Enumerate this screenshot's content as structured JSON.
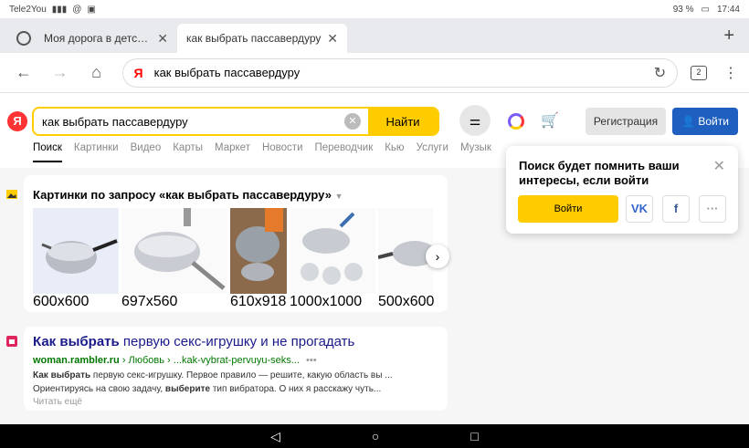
{
  "status": {
    "carrier": "Tele2You",
    "battery": "93 %",
    "time": "17:44"
  },
  "tabs": [
    {
      "title": "Моя дорога в детство - Стр"
    },
    {
      "title": "как выбрать пассавердуру"
    }
  ],
  "address": {
    "query": "как выбрать пассавердуру",
    "tab_count": "2"
  },
  "serp": {
    "logo": "Я",
    "search_value": "как выбрать пассавердуру",
    "find_label": "Найти",
    "register_label": "Регистрация",
    "login_label": "Войти",
    "tabs": [
      "Поиск",
      "Картинки",
      "Видео",
      "Карты",
      "Маркет",
      "Новости",
      "Переводчик",
      "Кью",
      "Услуги",
      "Музык"
    ]
  },
  "images": {
    "title": "Картинки по запросу «как выбрать пассавердуру»",
    "sizes": [
      "600x600",
      "697x560",
      "610x918",
      "1000x1000",
      "500x600"
    ]
  },
  "result": {
    "title_bold": "Как выбрать",
    "title_rest": " первую секс-игрушку и не прогадать",
    "url_domain": "woman.rambler.ru",
    "url_path": " › Любовь › ...kak-vybrat-pervuyu-seks...",
    "url_more": "•••",
    "snippet_1_bold": "Как выбрать",
    "snippet_1_rest": " первую секс-игрушку. Первое правило — решите, какую область вы ...",
    "snippet_2_pre": "Ориентируясь на свою задачу, ",
    "snippet_2_bold": "выберите",
    "snippet_2_post": " тип вибратора. О них я расскажу чуть...",
    "more": "Читать ещё"
  },
  "popup": {
    "text": "Поиск будет помнить ваши интересы, если войти",
    "login_label": "Войти",
    "vk_label": "VK",
    "fb_label": "f",
    "more_label": "···"
  },
  "colors": {
    "yandex_yellow": "#ffcc00",
    "yandex_red": "#ff3333",
    "login_blue": "#1f5fbf",
    "url_green": "#007700",
    "title_blue": "#1a1a8a"
  }
}
